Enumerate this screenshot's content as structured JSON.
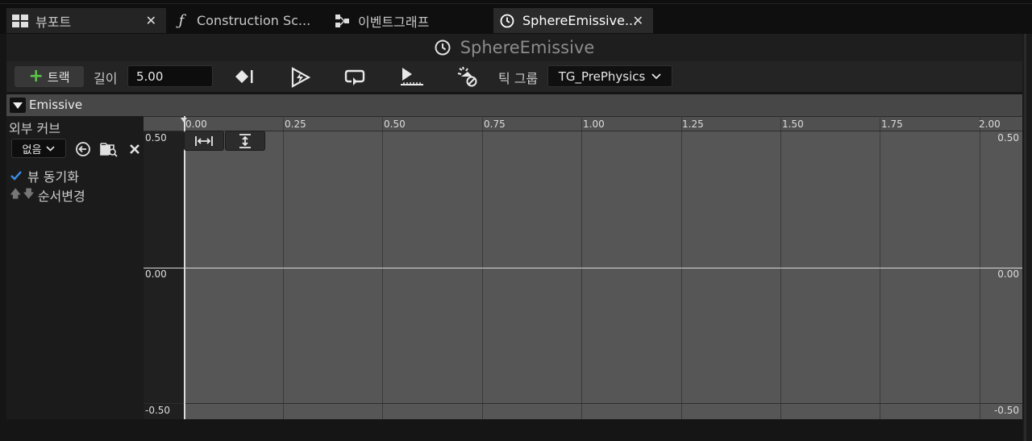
{
  "tabs": [
    {
      "label": "뷰포트",
      "icon": "viewport-grid-icon",
      "closable": true
    },
    {
      "label": "Construction Sc...",
      "icon": "function-icon",
      "closable": false
    },
    {
      "label": "이벤트그래프",
      "icon": "event-graph-icon",
      "closable": false
    },
    {
      "label": "SphereEmissive...",
      "icon": "timeline-clock-icon",
      "closable": true,
      "active": true
    }
  ],
  "tab_close_glyph": "✕",
  "title": "SphereEmissive",
  "toolbar": {
    "add_track_label": "트랙",
    "add_track_plus": "+",
    "length_label": "길이",
    "length_value": "5.00",
    "tick_group_label": "틱 그룹",
    "tick_group_value": "TG_PrePhysics",
    "icons": [
      "keyframe-autokey-icon",
      "autoplay-icon",
      "loop-icon",
      "use-last-keyframe-icon",
      "replicated-icon"
    ]
  },
  "track": {
    "name": "Emissive",
    "external_curve_label": "외부 커브",
    "external_curve_value": "없음",
    "sync_view_label": "뷰 동기화",
    "sync_view_checked": true,
    "reorder_label": "순서변경"
  },
  "graph": {
    "x_ticks": [
      "0.00",
      "0.25",
      "0.50",
      "0.75",
      "1.00",
      "1.25",
      "1.50",
      "1.75",
      "2.00"
    ],
    "y_labels_left": [
      "0.50",
      "0.00",
      "-0.50"
    ],
    "y_labels_right": [
      "0.50",
      "0.00",
      "-0.50"
    ],
    "fit_buttons": [
      "fit-horizontal-icon",
      "fit-vertical-icon"
    ]
  },
  "colors": {
    "accent_green": "#5cc24a",
    "check_blue": "#3b8fe8",
    "graph_bg": "#565656"
  }
}
